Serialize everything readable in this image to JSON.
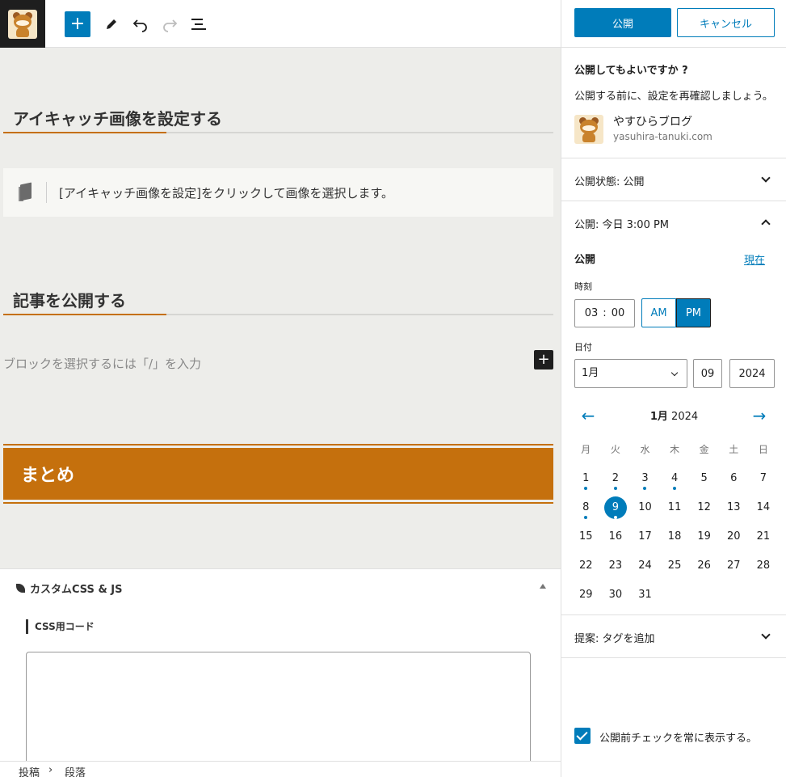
{
  "toolbar": {
    "add_symbol": "+",
    "icons": [
      "site-logo-icon",
      "plus-icon",
      "pen-icon",
      "undo-icon",
      "redo-icon",
      "list-view-icon"
    ]
  },
  "editor": {
    "heading1": "アイキャッチ画像を設定する",
    "note_text": "[アイキャッチ画像を設定]をクリックして画像を選択します。",
    "heading2": "記事を公開する",
    "placeholder": "ブロックを選択するには「/」を入力",
    "inline_add": "+",
    "matome": "まとめ",
    "accent_color": "#c5700d"
  },
  "meta_box": {
    "title": "カスタムCSS & JS",
    "css_label": "CSS用コード",
    "css_value": ""
  },
  "breadcrumb": {
    "item1": "投稿",
    "sep": "›",
    "item2": "段落"
  },
  "sidebar": {
    "publish_label": "公開",
    "cancel_label": "キャンセル",
    "question": "公開してもよいですか ?",
    "description": "公開する前に、設定を再確認しましょう。",
    "site_name": "やすひらブログ",
    "site_url": "yasuhira-tanuki.com",
    "status_row": "公開状態: 公開",
    "schedule_row": "公開: 今日 3:00 PM",
    "publish_heading": "公開",
    "now_link": "現在",
    "time_label": "時刻",
    "hour": "03",
    "colon": ":",
    "minute": "00",
    "am": "AM",
    "pm": "PM",
    "date_label": "日付",
    "month_value": "1月",
    "day_value": "09",
    "year_value": "2024",
    "calendar_month": "1月",
    "calendar_year": "2024",
    "prev_arrow": "←",
    "next_arrow": "→",
    "weekdays": [
      "月",
      "火",
      "水",
      "木",
      "金",
      "土",
      "日"
    ],
    "tags_row": "提案: タグを追加",
    "always_show_label": "公開前チェックを常に表示する。",
    "primary_color": "#007cba"
  }
}
